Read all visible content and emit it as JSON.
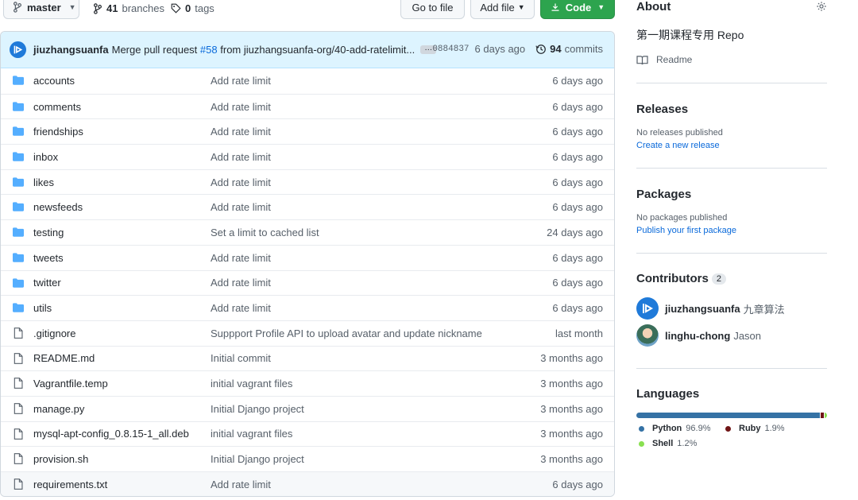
{
  "topbar": {
    "branch": "master",
    "branches_count": "41",
    "branches_label": "branches",
    "tags_count": "0",
    "tags_label": "tags",
    "goto_file": "Go to file",
    "add_file": "Add file",
    "code": "Code"
  },
  "commit": {
    "author": "jiuzhangsuanfa",
    "message_prefix": "Merge pull request",
    "pr": "#58",
    "message_suffix": "from jiuzhangsuanfa-org/40-add-ratelimit...",
    "ellipsis": "…",
    "sha": "0884837",
    "age": "6 days ago",
    "commits_count": "94",
    "commits_label": "commits"
  },
  "files": [
    {
      "type": "dir",
      "name": "accounts",
      "message": "Add rate limit",
      "age": "6 days ago"
    },
    {
      "type": "dir",
      "name": "comments",
      "message": "Add rate limit",
      "age": "6 days ago"
    },
    {
      "type": "dir",
      "name": "friendships",
      "message": "Add rate limit",
      "age": "6 days ago"
    },
    {
      "type": "dir",
      "name": "inbox",
      "message": "Add rate limit",
      "age": "6 days ago"
    },
    {
      "type": "dir",
      "name": "likes",
      "message": "Add rate limit",
      "age": "6 days ago"
    },
    {
      "type": "dir",
      "name": "newsfeeds",
      "message": "Add rate limit",
      "age": "6 days ago"
    },
    {
      "type": "dir",
      "name": "testing",
      "message": "Set a limit to cached list",
      "age": "24 days ago"
    },
    {
      "type": "dir",
      "name": "tweets",
      "message": "Add rate limit",
      "age": "6 days ago"
    },
    {
      "type": "dir",
      "name": "twitter",
      "message": "Add rate limit",
      "age": "6 days ago"
    },
    {
      "type": "dir",
      "name": "utils",
      "message": "Add rate limit",
      "age": "6 days ago"
    },
    {
      "type": "file",
      "name": ".gitignore",
      "message": "Suppport Profile API to upload avatar and update nickname",
      "age": "last month"
    },
    {
      "type": "file",
      "name": "README.md",
      "message": "Initial commit",
      "age": "3 months ago"
    },
    {
      "type": "file",
      "name": "Vagrantfile.temp",
      "message": "initial vagrant files",
      "age": "3 months ago"
    },
    {
      "type": "file",
      "name": "manage.py",
      "message": "Initial Django project",
      "age": "3 months ago"
    },
    {
      "type": "file",
      "name": "mysql-apt-config_0.8.15-1_all.deb",
      "message": "initial vagrant files",
      "age": "3 months ago"
    },
    {
      "type": "file",
      "name": "provision.sh",
      "message": "Initial Django project",
      "age": "3 months ago"
    },
    {
      "type": "file",
      "name": "requirements.txt",
      "message": "Add rate limit",
      "age": "6 days ago"
    }
  ],
  "sidebar": {
    "about": {
      "title": "About",
      "description": "第一期课程专用 Repo",
      "readme": "Readme"
    },
    "releases": {
      "title": "Releases",
      "empty": "No releases published",
      "link": "Create a new release"
    },
    "packages": {
      "title": "Packages",
      "empty": "No packages published",
      "link": "Publish your first package"
    },
    "contributors": {
      "title": "Contributors",
      "count": "2",
      "items": [
        {
          "login": "jiuzhangsuanfa",
          "name": "九章算法"
        },
        {
          "login": "linghu-chong",
          "name": "Jason"
        }
      ]
    },
    "languages": {
      "title": "Languages",
      "items": [
        {
          "name": "Python",
          "percent": "96.9%",
          "value": 96.9,
          "color": "#3572A5"
        },
        {
          "name": "Ruby",
          "percent": "1.9%",
          "value": 1.9,
          "color": "#701516"
        },
        {
          "name": "Shell",
          "percent": "1.2%",
          "value": 1.2,
          "color": "#89e051"
        }
      ]
    }
  },
  "colors": {
    "accent": "#0969da",
    "code_button": "#2da44e",
    "folder": "#54aeff",
    "commit_bar": "#ddf4ff"
  }
}
